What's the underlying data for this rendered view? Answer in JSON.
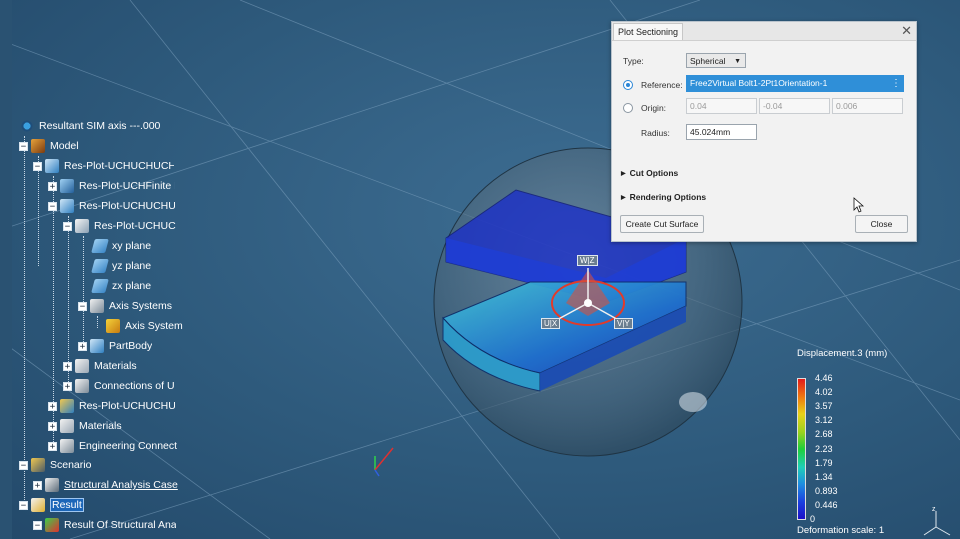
{
  "tree": {
    "root": "Resultant SIM axis ---.000",
    "model": "Model",
    "res1": "Res-Plot-UCHUCHUCH-",
    "res2": "Res-Plot-UCHFinite E",
    "res3": "Res-Plot-UCHUCHUC",
    "res4": "Res-Plot-UCHUCI",
    "xy": "xy plane",
    "yz": "yz plane",
    "zx": "zx plane",
    "axis_systems": "Axis Systems",
    "axis_system": "Axis System",
    "partbody": "PartBody",
    "materials1": "Materials",
    "connections": "Connections of U",
    "res5": "Res-Plot-UCHUCHUC",
    "materials2": "Materials",
    "eng_conn": "Engineering Connect",
    "scenario": "Scenario",
    "sac": "Structural Analysis Case",
    "result": "Result",
    "result_of": "Result Of Structural Ana"
  },
  "dialog": {
    "title": "Plot Sectioning",
    "type_label": "Type:",
    "type_value": "Spherical",
    "reference_label": "Reference:",
    "reference_value": "Free2Virtual Bolt1-2Pt1Orientation-1",
    "origin_label": "Origin:",
    "origin_x": "0.04",
    "origin_y": "-0.04",
    "origin_z": "0.006",
    "radius_label": "Radius:",
    "radius_value": "45.024mm",
    "cut_options": "Cut Options",
    "rendering_options": "Rendering Options",
    "create_button": "Create Cut Surface",
    "close_button": "Close"
  },
  "model3d": {
    "w_label": "W|Z",
    "u_label": "U|X",
    "v_label": "V|Y"
  },
  "legend": {
    "title": "Displacement.3 (mm)",
    "values": [
      "4.46",
      "4.02",
      "3.57",
      "3.12",
      "2.68",
      "2.23",
      "1.79",
      "1.34",
      "0.893",
      "0.446",
      "0"
    ],
    "deformation": "Deformation scale: 1"
  },
  "colors": {
    "background": "#2e5a7c",
    "selection": "#1c66b8",
    "accent": "#2f8fd8"
  }
}
